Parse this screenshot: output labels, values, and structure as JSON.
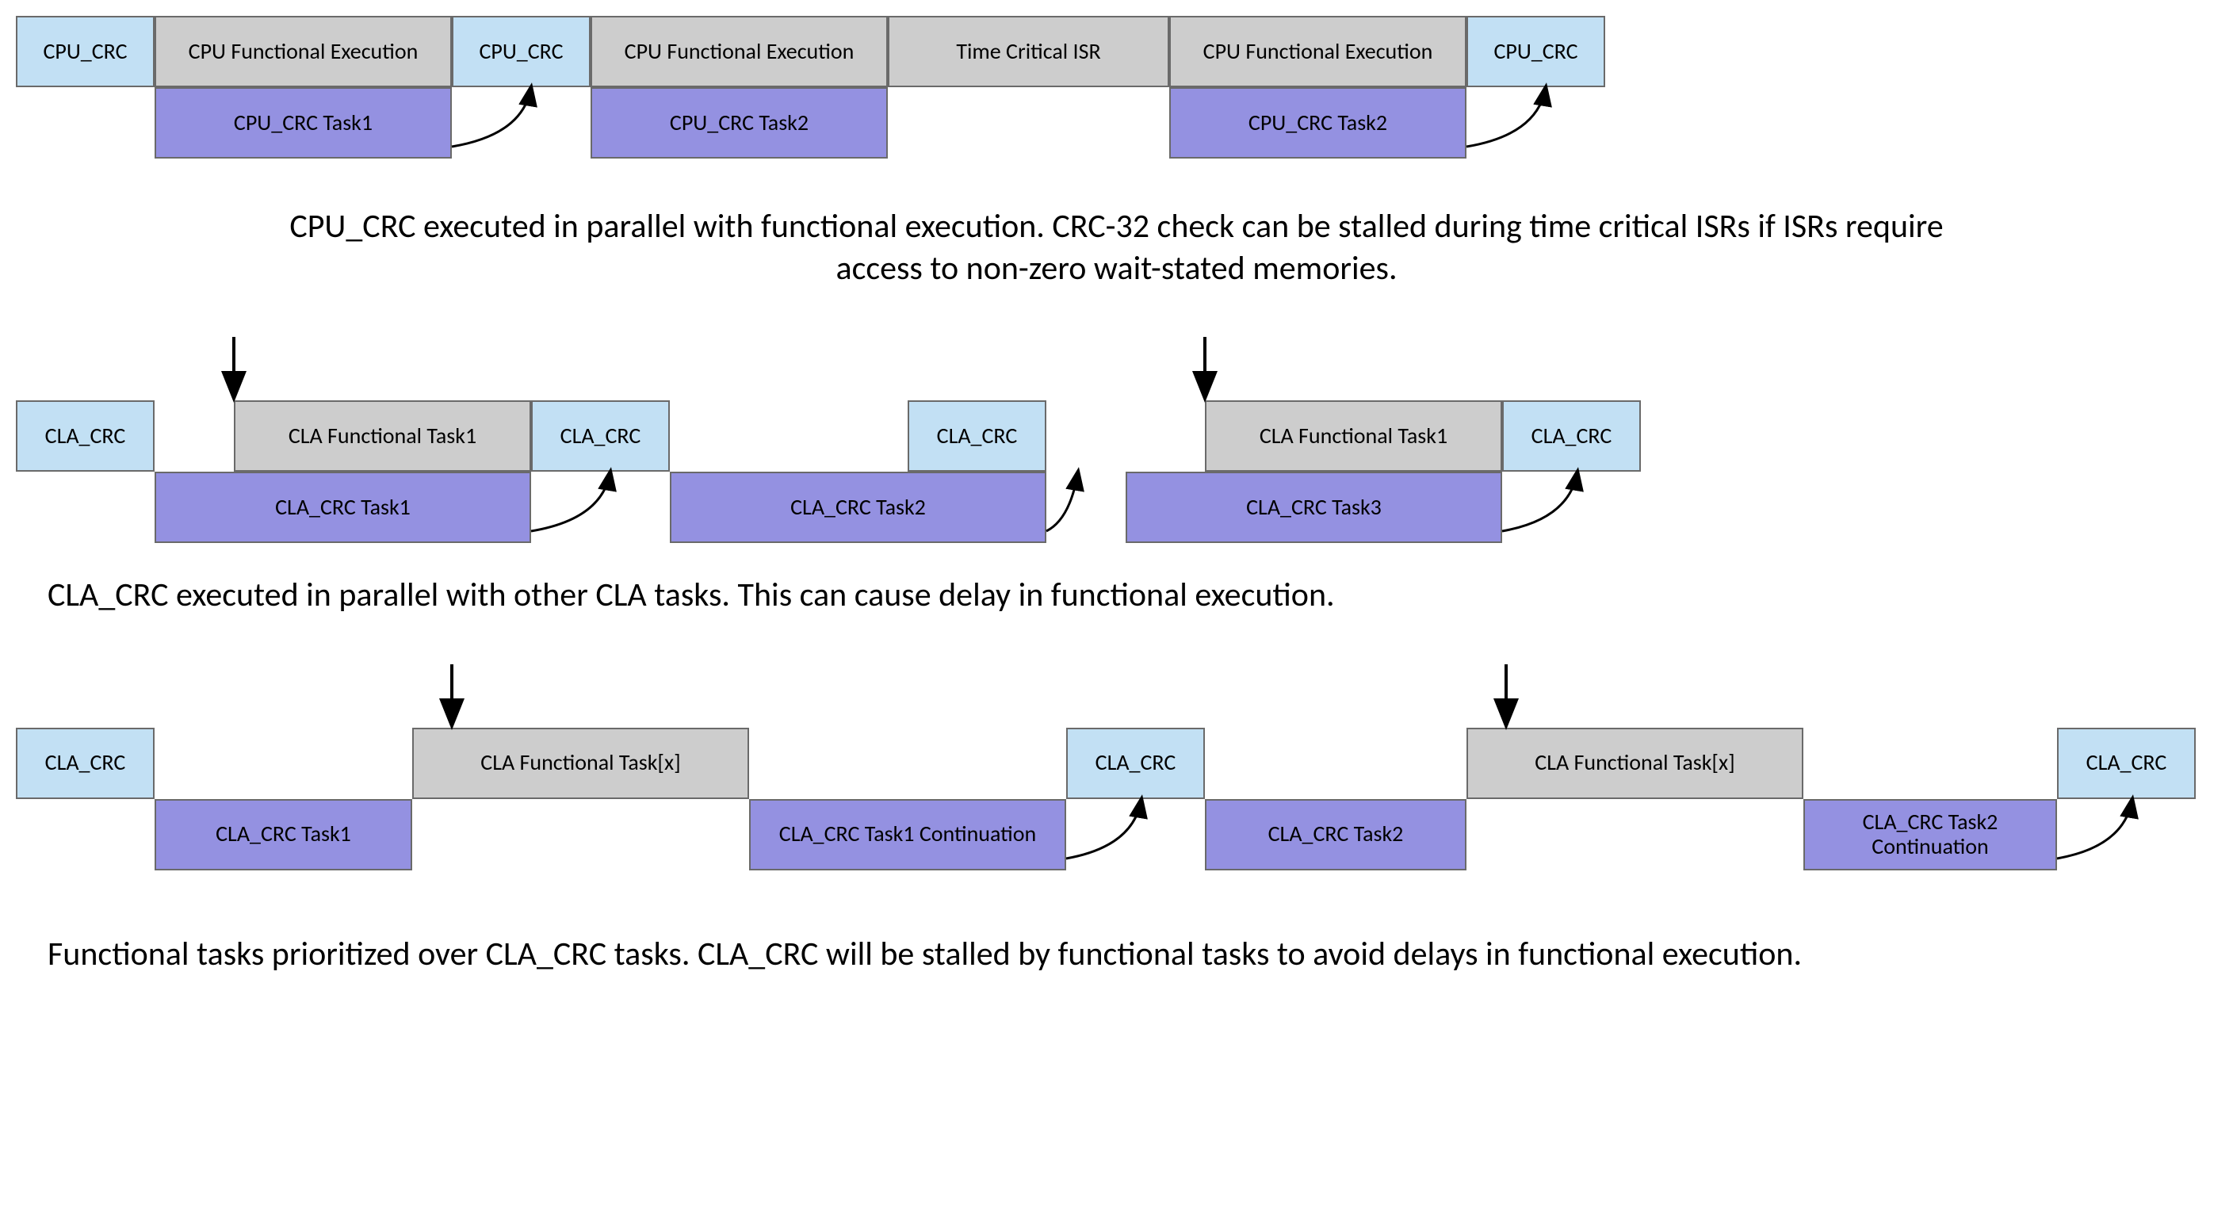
{
  "colors": {
    "blue": "#c2e0f4",
    "grey": "#cdcdcd",
    "purple": "#9491e1",
    "border": "#6a6a6a"
  },
  "section1": {
    "top_row": [
      {
        "label": "CPU_CRC",
        "color": "blue"
      },
      {
        "label": "CPU Functional Execution",
        "color": "grey"
      },
      {
        "label": "CPU_CRC",
        "color": "blue"
      },
      {
        "label": "CPU Functional Execution",
        "color": "grey"
      },
      {
        "label": "Time Critical ISR",
        "color": "grey"
      },
      {
        "label": "CPU Functional Execution",
        "color": "grey"
      },
      {
        "label": "CPU_CRC",
        "color": "blue"
      }
    ],
    "bottom_row": [
      {
        "label": "CPU_CRC Task1",
        "color": "purple"
      },
      {
        "label": "CPU_CRC Task2",
        "color": "purple"
      },
      {
        "label": "CPU_CRC Task2",
        "color": "purple"
      }
    ],
    "caption": "CPU_CRC executed in parallel with functional execution. CRC-32 check can be stalled during time critical ISRs if ISRs require access to non-zero wait-stated memories."
  },
  "section2": {
    "top_row": [
      {
        "label": "CLA_CRC",
        "color": "blue"
      },
      {
        "label": "CLA Functional Task1",
        "color": "grey"
      },
      {
        "label": "CLA_CRC",
        "color": "blue"
      },
      {
        "label": "CLA_CRC",
        "color": "blue"
      },
      {
        "label": "CLA Functional Task1",
        "color": "grey"
      },
      {
        "label": "CLA_CRC",
        "color": "blue"
      }
    ],
    "bottom_row": [
      {
        "label": "CLA_CRC Task1",
        "color": "purple"
      },
      {
        "label": "CLA_CRC Task2",
        "color": "purple"
      },
      {
        "label": "CLA_CRC Task3",
        "color": "purple"
      }
    ],
    "caption": "CLA_CRC executed in parallel with other CLA tasks. This can cause delay in functional execution."
  },
  "section3": {
    "top_row": [
      {
        "label": "CLA_CRC",
        "color": "blue"
      },
      {
        "label": "CLA Functional Task[x]",
        "color": "grey"
      },
      {
        "label": "CLA_CRC",
        "color": "blue"
      },
      {
        "label": "CLA Functional Task[x]",
        "color": "grey"
      },
      {
        "label": "CLA_CRC",
        "color": "blue"
      }
    ],
    "bottom_row": [
      {
        "label": "CLA_CRC Task1",
        "color": "purple"
      },
      {
        "label": "CLA_CRC Task1 Continuation",
        "color": "purple"
      },
      {
        "label": "CLA_CRC Task2",
        "color": "purple"
      },
      {
        "label": "CLA_CRC Task2 Continuation",
        "color": "purple"
      }
    ],
    "caption": "Functional tasks prioritized over CLA_CRC tasks. CLA_CRC will be stalled by functional tasks to avoid delays in functional execution."
  }
}
